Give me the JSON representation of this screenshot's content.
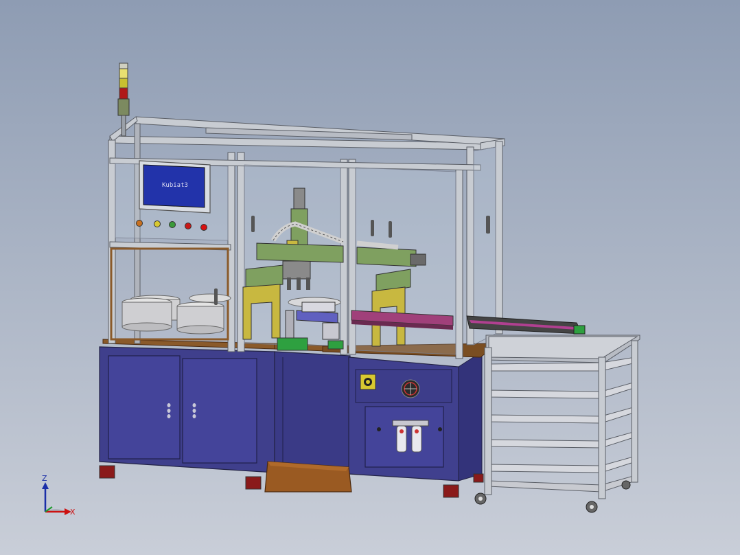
{
  "viewport": {
    "background_top": "#8e9cb3",
    "background_bottom": "#c9ced8"
  },
  "hmi": {
    "screen_text": "Kubiat3",
    "screen_color": "#2233aa"
  },
  "triad": {
    "z_label": "Z",
    "x_label": "X",
    "z_color": "#1a2ea8",
    "x_color": "#cc1111",
    "y_color": "#1a9a2a"
  },
  "colors": {
    "cabinet": "#3f3f8c",
    "frame": "#c8ccd2",
    "gantry_green": "#7fa060",
    "fixture_yellow": "#c8b840",
    "worktop": "#8a5a2a",
    "bin": "#9a5a22"
  },
  "icons": [
    "stack-light-icon",
    "power-switch-icon",
    "fan-icon",
    "air-filter-icon",
    "caster-icon",
    "coordinate-triad-icon"
  ]
}
